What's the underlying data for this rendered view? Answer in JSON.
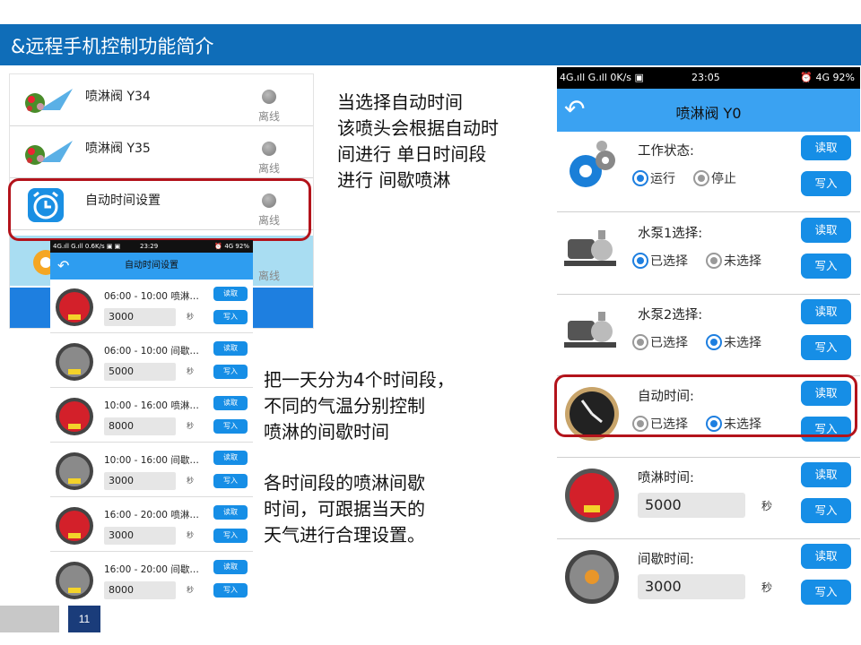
{
  "slide": {
    "title": "&远程手机控制功能简介",
    "page_number": "11",
    "note1": "当选择自动时间\n该喷头会根据自动时\n间进行 单日时间段\n进行 间歇喷淋",
    "note2": "把一天分为4个时间段，\n不同的气温分别控制\n喷淋的间歇时间",
    "note3": "各时间段的喷淋间歇\n时间，可跟据当天的\n天气进行合理设置。",
    "highlight_color": "#b3131b",
    "accent_color": "#0f6db8"
  },
  "device_list": {
    "items": [
      {
        "name": "喷淋阀 Y34",
        "state": "离线",
        "icon": "sprinkler-icon"
      },
      {
        "name": "喷淋阀 Y35",
        "state": "离线",
        "icon": "sprinkler-icon"
      },
      {
        "name": "自动时间设置",
        "state": "离线",
        "icon": "alarm-clock-icon"
      },
      {
        "name": "",
        "state": "离线",
        "icon": "gear-icon"
      }
    ]
  },
  "small_phone": {
    "status_left": "4G.ıll G.ıll 0.6K/s ▣ ▣",
    "status_time": "23:29",
    "status_right": "⏰ 4G 92%",
    "header_title": "自动时间设置",
    "read_label": "读取",
    "write_label": "写入",
    "unit": "秒",
    "rows": [
      {
        "label": "06:00 - 10:00 喷淋…",
        "value": "3000",
        "gauge": "red"
      },
      {
        "label": "06:00 - 10:00 间歇…",
        "value": "5000",
        "gauge": "grey"
      },
      {
        "label": "10:00 - 16:00 喷淋…",
        "value": "8000",
        "gauge": "red"
      },
      {
        "label": "10:00 - 16:00 间歇…",
        "value": "3000",
        "gauge": "grey"
      },
      {
        "label": "16:00 - 20:00 喷淋…",
        "value": "3000",
        "gauge": "red"
      },
      {
        "label": "16:00 - 20:00 间歇…",
        "value": "8000",
        "gauge": "grey"
      }
    ]
  },
  "right_phone": {
    "status_left": "4G.ıll G.ıll 0K/s ▣",
    "status_time": "23:05",
    "status_right": "⏰ 4G 92%",
    "header_title": "喷淋阀 Y0",
    "read_label": "读取",
    "write_label": "写入",
    "unit": "秒",
    "work_state": {
      "label": "工作状态:",
      "opt1": "运行",
      "opt2": "停止"
    },
    "pump1": {
      "label": "水泵1选择:",
      "opt1": "已选择",
      "opt2": "未选择"
    },
    "pump2": {
      "label": "水泵2选择:",
      "opt1": "已选择",
      "opt2": "未选择"
    },
    "auto_time": {
      "label": "自动时间:",
      "opt1": "已选择",
      "opt2": "未选择"
    },
    "spray_time": {
      "label": "喷淋时间:",
      "value": "5000"
    },
    "pause_time": {
      "label": "间歇时间:",
      "value": "3000"
    }
  }
}
